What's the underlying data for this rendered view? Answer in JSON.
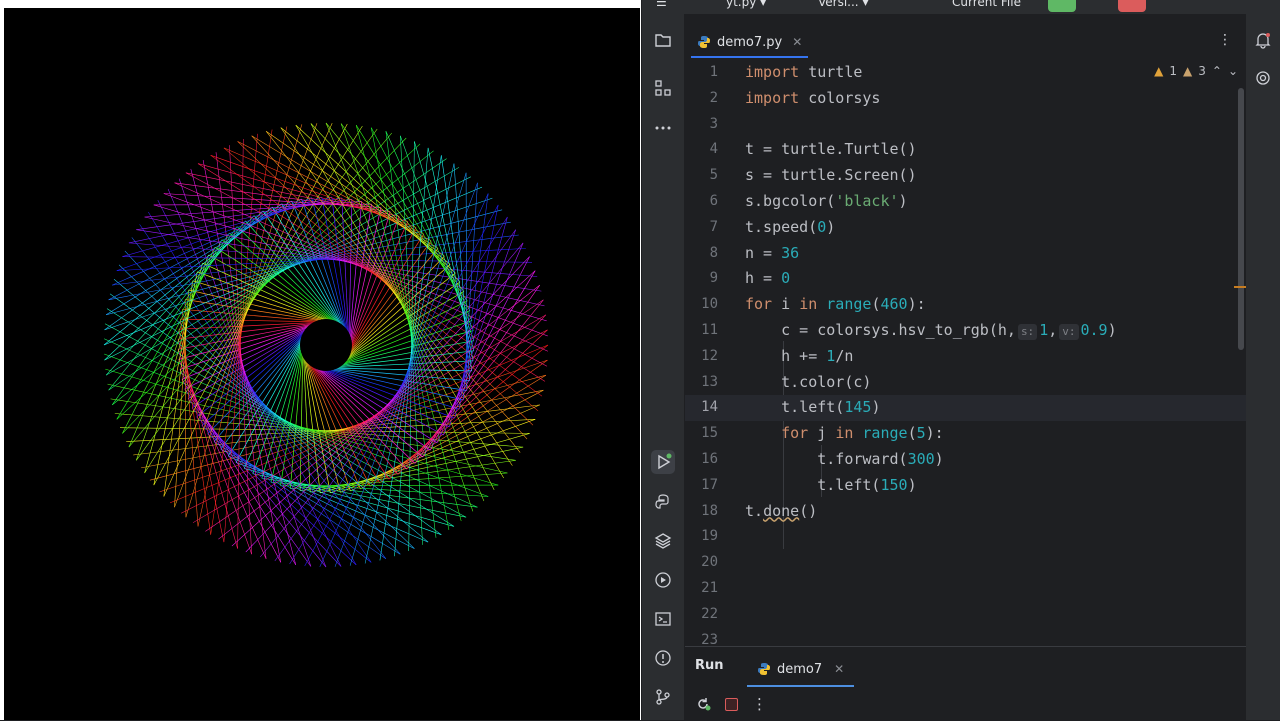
{
  "colors": {
    "keyword": "#cf8e6d",
    "number": "#2aacb8",
    "string": "#6aab73",
    "accent": "#3574f0",
    "run_green": "#5fb865",
    "stop_red": "#db5c5c"
  },
  "turtle_window": {
    "background": "#000000"
  },
  "topbar": {
    "project": "yt.py",
    "vcs": "Versi...",
    "run_config": "Current File"
  },
  "editor_tab": {
    "label": "demo7.py",
    "icon": "python-icon"
  },
  "inspections": {
    "warnings": "1",
    "weak_warnings": "3"
  },
  "hints": {
    "s": "s:",
    "v": "v:"
  },
  "code": {
    "line_numbers": [
      "1",
      "2",
      "3",
      "4",
      "5",
      "6",
      "7",
      "8",
      "9",
      "10",
      "11",
      "12",
      "13",
      "14",
      "15",
      "16",
      "17",
      "18",
      "19",
      "20",
      "21",
      "22",
      "23"
    ],
    "current_line": 14,
    "l1": {
      "kw": "import",
      "rest": " turtle"
    },
    "l2": {
      "kw": "import",
      "rest": " colorsys"
    },
    "l4": {
      "text": "t = turtle.Turtle()"
    },
    "l5": {
      "text": "s = turtle.Screen()"
    },
    "l6": {
      "a": "s.bgcolor(",
      "str": "'black'",
      "b": ")"
    },
    "l7": {
      "a": "t.speed(",
      "num": "0",
      "b": ")"
    },
    "l8": {
      "a": "n = ",
      "num": "36"
    },
    "l9": {
      "a": "h = ",
      "num": "0"
    },
    "l10": {
      "kw1": "for",
      "a": " i ",
      "kw2": "in",
      "b": " ",
      "fn": "range",
      "c": "(",
      "num": "460",
      "d": "):"
    },
    "l11": {
      "a": "    c = colorsys.hsv_to_rgb(h,",
      "num1": "1",
      "sep": ",",
      "num2": "0.9",
      "b": ")"
    },
    "l12": {
      "a": "    h += ",
      "num": "1",
      "b": "/n"
    },
    "l13": {
      "text": "    t.color(c)"
    },
    "l14": {
      "a": "    t.left(",
      "num": "145",
      "b": ")"
    },
    "l15": {
      "a": "    ",
      "kw1": "for",
      "b": " j ",
      "kw2": "in",
      "c": " ",
      "fn": "range",
      "d": "(",
      "num": "5",
      "e": "):"
    },
    "l16": {
      "a": "        t.forward(",
      "num": "300",
      "b": ")"
    },
    "l17": {
      "a": "        t.left(",
      "num": "150",
      "b": ")"
    },
    "l18": {
      "a": "t.",
      "warn": "done",
      "b": "()"
    }
  },
  "run_panel": {
    "title": "Run",
    "tab": "demo7"
  }
}
